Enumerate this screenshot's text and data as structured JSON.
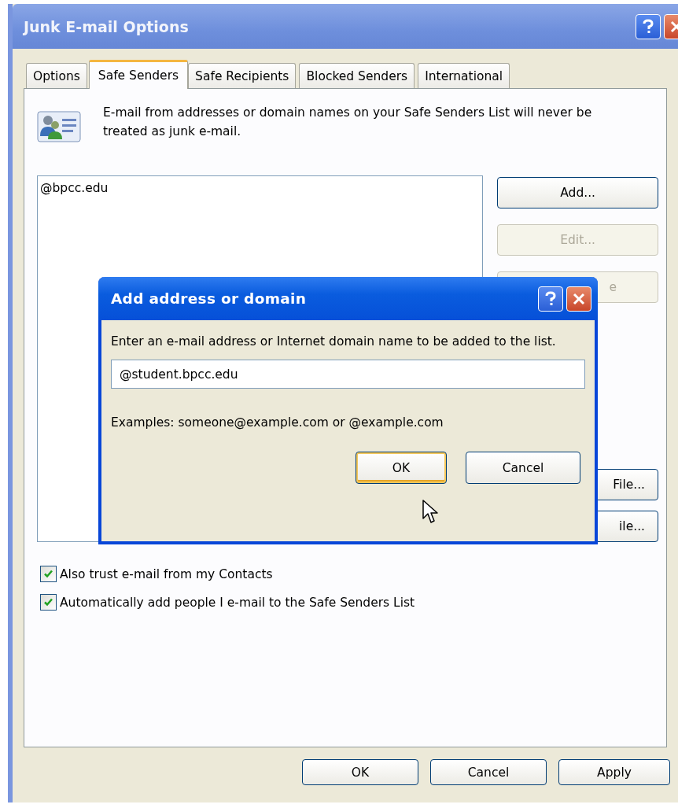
{
  "window": {
    "title": "Junk E-mail Options"
  },
  "tabs": [
    {
      "label": "Options",
      "selected": false
    },
    {
      "label": "Safe Senders",
      "selected": true
    },
    {
      "label": "Safe Recipients",
      "selected": false
    },
    {
      "label": "Blocked Senders",
      "selected": false
    },
    {
      "label": "International",
      "selected": false
    }
  ],
  "description": "E-mail from addresses or domain names on your Safe Senders List will never be treated as junk e-mail.",
  "safe_senders_list": {
    "items": [
      "@bpcc.edu"
    ]
  },
  "side_buttons": [
    {
      "label": "Add...",
      "disabled": false
    },
    {
      "label": "Edit...",
      "disabled": true
    },
    {
      "label": "e",
      "disabled": true
    },
    {
      "label": "File...",
      "disabled": false
    },
    {
      "label": "ile...",
      "disabled": false
    }
  ],
  "checkboxes": [
    {
      "label": "Also trust e-mail from my Contacts",
      "checked": true
    },
    {
      "label": "Automatically add people I e-mail to the Safe Senders List",
      "checked": true
    }
  ],
  "buttons": [
    "OK",
    "Cancel",
    "Apply"
  ],
  "dialog": {
    "title": "Add address or domain",
    "prompt": "Enter an e-mail address or Internet domain name to be added to the list.",
    "value": "@student.bpcc.edu",
    "examples": "Examples: someone@example.com or @example.com",
    "buttons": [
      {
        "label": "OK",
        "default": true
      },
      {
        "label": "Cancel",
        "default": false
      }
    ]
  }
}
